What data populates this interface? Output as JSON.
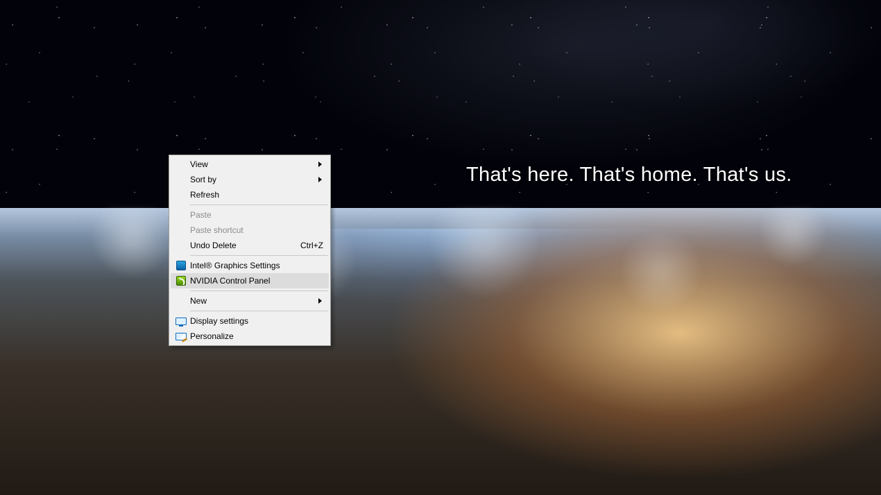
{
  "wallpaper": {
    "caption": "That's here. That's home. That's us."
  },
  "context_menu": {
    "items": [
      {
        "label": "View",
        "submenu": true,
        "enabled": true,
        "icon": null,
        "accel": null
      },
      {
        "label": "Sort by",
        "submenu": true,
        "enabled": true,
        "icon": null,
        "accel": null
      },
      {
        "label": "Refresh",
        "submenu": false,
        "enabled": true,
        "icon": null,
        "accel": null
      },
      {
        "sep": true
      },
      {
        "label": "Paste",
        "submenu": false,
        "enabled": false,
        "icon": null,
        "accel": null
      },
      {
        "label": "Paste shortcut",
        "submenu": false,
        "enabled": false,
        "icon": null,
        "accel": null
      },
      {
        "label": "Undo Delete",
        "submenu": false,
        "enabled": true,
        "icon": null,
        "accel": "Ctrl+Z"
      },
      {
        "sep": true
      },
      {
        "label": "Intel® Graphics Settings",
        "submenu": false,
        "enabled": true,
        "icon": "intel-icon",
        "accel": null
      },
      {
        "label": "NVIDIA Control Panel",
        "submenu": false,
        "enabled": true,
        "icon": "nvidia-icon",
        "accel": null,
        "hovered": true
      },
      {
        "sep": true
      },
      {
        "label": "New",
        "submenu": true,
        "enabled": true,
        "icon": null,
        "accel": null
      },
      {
        "sep": true
      },
      {
        "label": "Display settings",
        "submenu": false,
        "enabled": true,
        "icon": "display-icon",
        "accel": null
      },
      {
        "label": "Personalize",
        "submenu": false,
        "enabled": true,
        "icon": "personalize-icon",
        "accel": null
      }
    ]
  }
}
